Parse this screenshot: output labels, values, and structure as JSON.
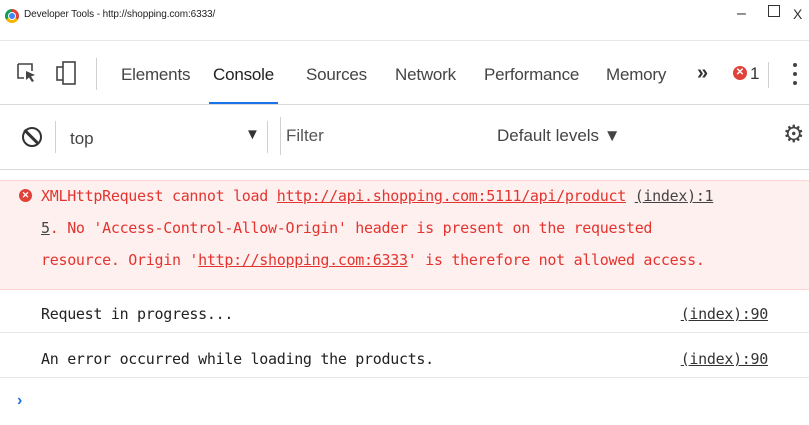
{
  "window": {
    "title": "Developer Tools - http://shopping.com:6333/",
    "minimize": "–",
    "close": "X"
  },
  "tabs": {
    "items": [
      {
        "label": "Elements"
      },
      {
        "label": "Console"
      },
      {
        "label": "Sources"
      },
      {
        "label": "Network"
      },
      {
        "label": "Performance"
      },
      {
        "label": "Memory"
      }
    ],
    "active": "Console",
    "overflow": "»",
    "error_count": "1"
  },
  "console_toolbar": {
    "context": "top",
    "context_arrow": "▼",
    "filter_placeholder": "Filter",
    "levels": "Default levels ▼"
  },
  "messages": {
    "error": {
      "line1_text": "XMLHttpRequest cannot load ",
      "line1_url": "http://api.shopping.com:5111/api/product",
      "line1_src": "(index):1",
      "line2_src_tail": "5",
      "line2_text": ". No 'Access-Control-Allow-Origin' header is present on the requested",
      "line3_pre": "resource. Origin '",
      "line3_url": "http://shopping.com:6333",
      "line3_post": "' is therefore not allowed access."
    },
    "logs": [
      {
        "text": "Request in progress...",
        "source": "(index):90"
      },
      {
        "text": "An error occurred while loading the products.",
        "source": "(index):90"
      }
    ],
    "prompt": "›"
  },
  "colors": {
    "error_text": "#e3342f",
    "error_bg": "#fff0f0",
    "accent": "#1a73e8"
  }
}
